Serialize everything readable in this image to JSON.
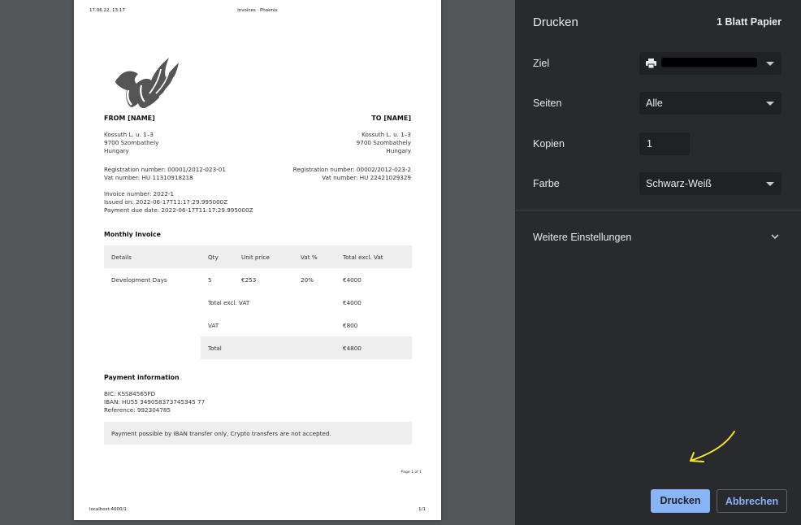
{
  "preview": {
    "header": {
      "datetime": "17.06.22, 13:17",
      "title": "Invoices · Phoenix"
    },
    "from": {
      "title": "FROM [NAME]",
      "address": [
        "Kossuth L. u. 1–3",
        "9700 Szombathely",
        "Hungary"
      ],
      "registration": "Registration number: 00001/2012-023-01",
      "vat": "Vat number: HU 11310918218"
    },
    "to": {
      "title": "TO [NAME]",
      "address": [
        "Kossuth L. u. 1–3",
        "9700 Szombathely",
        "Hungary"
      ],
      "registration": "Registration number: 00002/2012-023-2",
      "vat": "Vat number: HU 22421029329"
    },
    "invoice_meta": [
      "Invoice number: 2022-1",
      "Issued on: 2022-06-17T11:17:29.995000Z",
      "Payment due date: 2022-06-17T11:17:29.995000Z"
    ],
    "section_title": "Monthly Invoice",
    "table": {
      "headers": [
        "Details",
        "Qty",
        "Unit price",
        "Vat %",
        "Total excl. Vat"
      ],
      "item": [
        "Development Days",
        "5",
        "€253",
        "20%",
        "€4000"
      ],
      "subtotal_label": "Total excl. VAT",
      "subtotal_value": "€4000",
      "vat_label": "VAT",
      "vat_value": "€800",
      "total_label": "Total",
      "total_value": "€4800"
    },
    "payment": {
      "title": "Payment information",
      "bic": "BIC: KSS84565FD",
      "iban": "IBAN: HU55 349058373745345 77",
      "reference": "Reference: 992304785",
      "notice": "Payment possible by IBAN transfer only, Crypto transfers are not accepted."
    },
    "page_info": "Page 1 of 1",
    "footer": {
      "url": "localhost:4000/1",
      "page": "1/1"
    }
  },
  "panel": {
    "title": "Drucken",
    "sheets": "1 Blatt Papier",
    "destination_label": "Ziel",
    "pages_label": "Seiten",
    "pages_value": "Alle",
    "copies_label": "Kopien",
    "copies_value": "1",
    "color_label": "Farbe",
    "color_value": "Schwarz-Weiß",
    "more_settings": "Weitere Einstellungen",
    "print_button": "Drucken",
    "cancel_button": "Abbrechen"
  },
  "colors": {
    "panel_bg": "#292a2d",
    "field_bg": "#202124",
    "accent": "#8ab4f8",
    "annotation": "#f5e62a"
  },
  "icons": [
    "printer-icon",
    "chevron-down-icon",
    "arrow-annotation"
  ]
}
